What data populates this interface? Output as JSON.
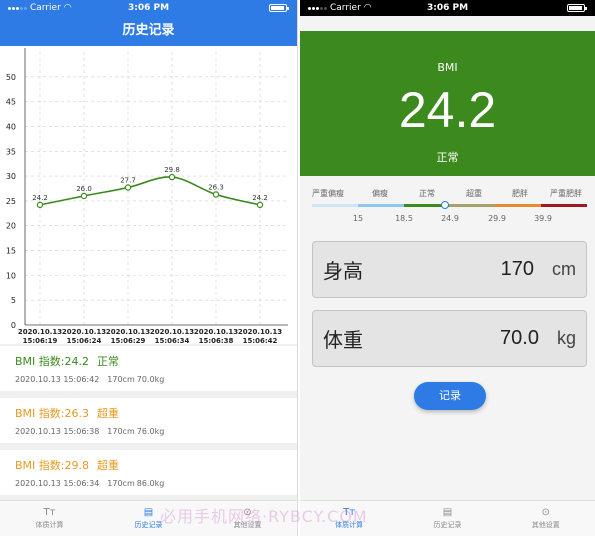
{
  "left_screen": {
    "status": {
      "carrier": "Carrier",
      "time": "3:06 PM"
    },
    "nav_title": "历史记录",
    "chart_data": {
      "type": "line",
      "y_ticks": [
        "0",
        "5",
        "10",
        "15",
        "20",
        "25",
        "30",
        "35",
        "40",
        "45",
        "50"
      ],
      "ylim": [
        0,
        55
      ],
      "x": [
        [
          "2020.10.13",
          "15:06:19"
        ],
        [
          "2020.10.13",
          "15:06:24"
        ],
        [
          "2020.10.13",
          "15:06:29"
        ],
        [
          "2020.10.13",
          "15:06:34"
        ],
        [
          "2020.10.13",
          "15:06:38"
        ],
        [
          "2020.10.13",
          "15:06:42"
        ]
      ],
      "values": [
        24.2,
        26.0,
        27.7,
        29.8,
        26.3,
        24.2
      ],
      "data_labels": [
        "24.2",
        "26.0",
        "27.7",
        "29.8",
        "26.3",
        "24.2"
      ],
      "line_color": "#3c8a1e",
      "grid": true
    },
    "history": [
      {
        "title": "BMI 指数:24.2",
        "status": "正常",
        "color": "#3c8a1e",
        "datetime": "2020.10.13 15:06:42",
        "height": "170cm",
        "weight": "70.0kg"
      },
      {
        "title": "BMI 指数:26.3",
        "status": "超重",
        "color": "#e69a22",
        "datetime": "2020.10.13 15:06:38",
        "height": "170cm",
        "weight": "76.0kg"
      },
      {
        "title": "BMI 指数:29.8",
        "status": "超重",
        "color": "#e69a22",
        "datetime": "2020.10.13 15:06:34",
        "height": "170cm",
        "weight": "86.0kg"
      }
    ],
    "tabs": [
      {
        "label": "体质计算",
        "icon": "calc-icon",
        "glyph": "Tт"
      },
      {
        "label": "历史记录",
        "icon": "history-icon",
        "glyph": "▤"
      },
      {
        "label": "其他设置",
        "icon": "settings-icon",
        "glyph": "⊙"
      }
    ]
  },
  "right_screen": {
    "status": {
      "carrier": "Carrier",
      "time": "3:06 PM"
    },
    "bmi_label": "BMI",
    "bmi_value": "24.2",
    "bmi_status": "正常",
    "header_color": "#3c8a1e",
    "scale_labels": [
      "严重偏瘦",
      "偏瘦",
      "正常",
      "超重",
      "肥胖",
      "严重肥胖"
    ],
    "scale_colors": [
      "#cfe6f5",
      "#8cc8ee",
      "#3c8a1e",
      "#a6a26e",
      "#e68a33",
      "#a01824"
    ],
    "scale_ticks": [
      "15",
      "18.5",
      "24.9",
      "29.9",
      "39.9"
    ],
    "height": {
      "label": "身高",
      "value": "170",
      "unit": "cm"
    },
    "weight": {
      "label": "体重",
      "value": "70.0",
      "unit": "kg"
    },
    "record_button": "记录",
    "tabs": [
      {
        "label": "体质计算",
        "icon": "calc-icon",
        "glyph": "Tт"
      },
      {
        "label": "历史记录",
        "icon": "history-icon",
        "glyph": "▤"
      },
      {
        "label": "其他设置",
        "icon": "settings-icon",
        "glyph": "⊙"
      }
    ]
  },
  "watermark": "必用手机网络·RYBCY.COM"
}
